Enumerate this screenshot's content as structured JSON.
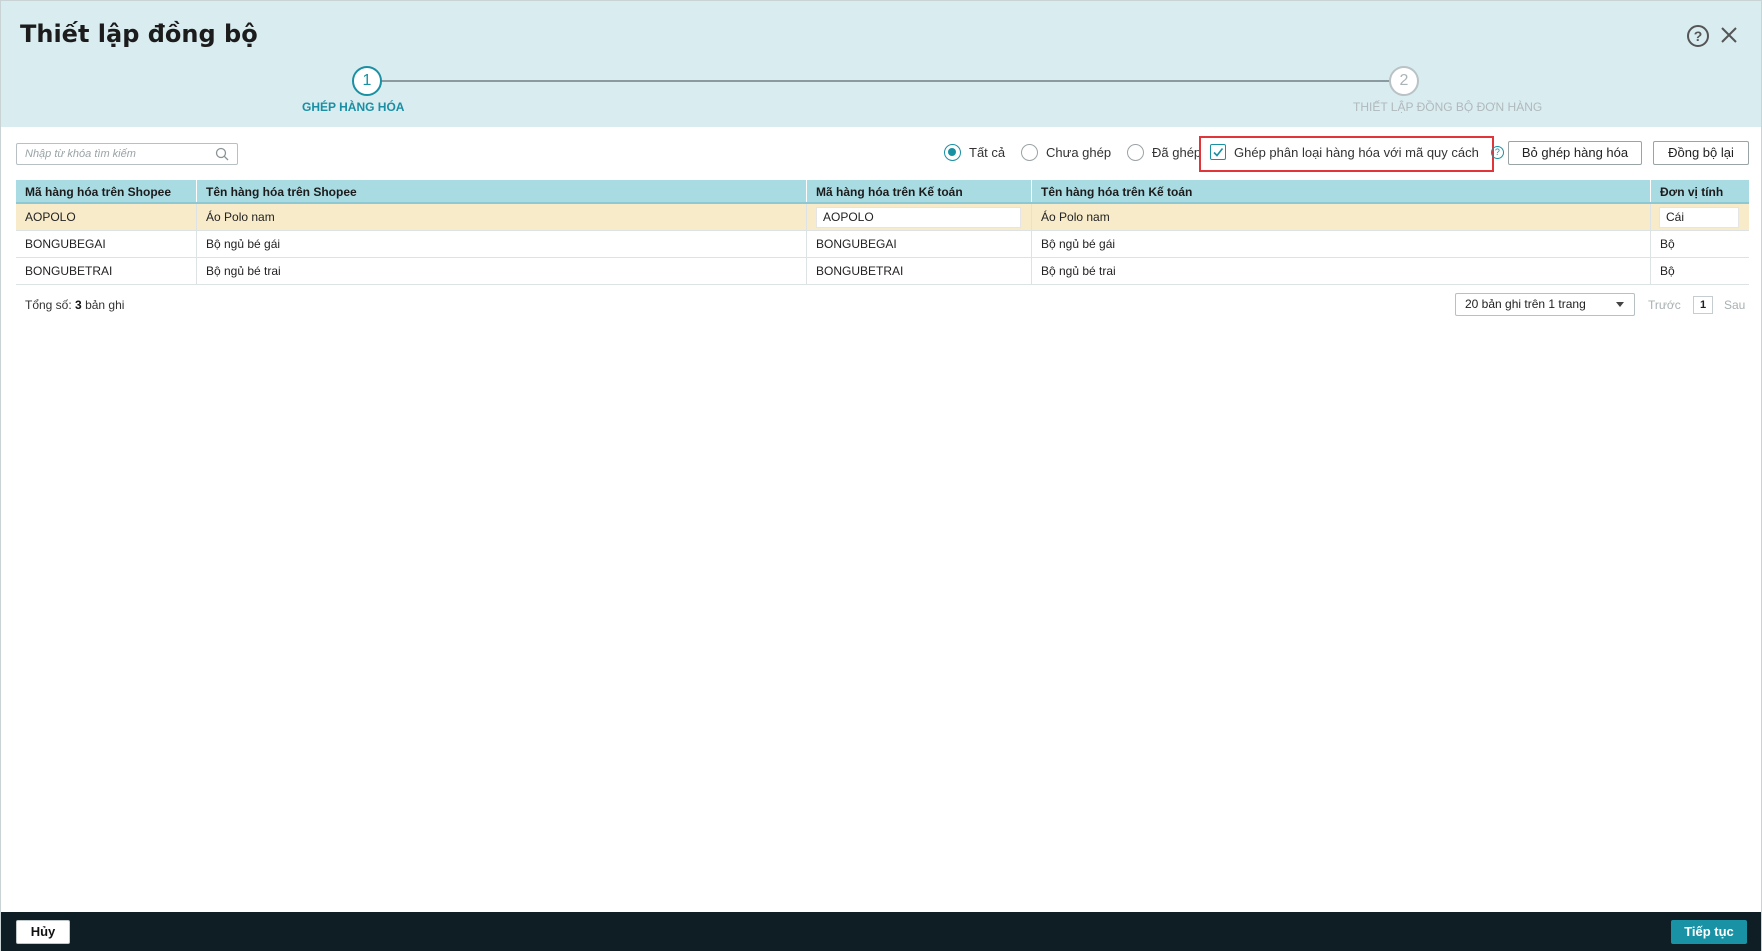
{
  "dialog": {
    "title": "Thiết lập đồng bộ",
    "help_label": "?"
  },
  "stepper": {
    "steps": [
      {
        "number": "1",
        "label": "GHÉP HÀNG HÓA",
        "state": "active"
      },
      {
        "number": "2",
        "label": "THIẾT LẬP ĐỒNG BỘ ĐƠN HÀNG",
        "state": "inactive"
      }
    ]
  },
  "toolbar": {
    "search_placeholder": "Nhập từ khóa tìm kiếm",
    "filters": [
      {
        "label": "Tất cả",
        "checked": true
      },
      {
        "label": "Chưa ghép",
        "checked": false
      },
      {
        "label": "Đã ghép",
        "checked": false
      }
    ],
    "checkbox_label": "Ghép phân loại hàng hóa với mã quy cách",
    "checkbox_checked": true,
    "unmatch_button": "Bỏ ghép hàng hóa",
    "resync_button": "Đồng bộ lại"
  },
  "table": {
    "headers": [
      "Mã hàng hóa trên Shopee",
      "Tên hàng hóa trên Shopee",
      "Mã hàng hóa trên Kế toán",
      "Tên hàng hóa trên Kế toán",
      "Đơn vị tính"
    ],
    "rows": [
      [
        "AOPOLO",
        "Áo Polo nam",
        "AOPOLO",
        "Áo Polo nam",
        "Cái"
      ],
      [
        "BONGUBEGAI",
        "Bộ ngủ bé gái",
        "BONGUBEGAI",
        "Bộ ngủ bé gái",
        "Bộ"
      ],
      [
        "BONGUBETRAI",
        "Bộ ngủ bé trai",
        "BONGUBETRAI",
        "Bộ ngủ bé trai",
        "Bộ"
      ]
    ]
  },
  "summary": {
    "total_prefix": "Tổng số:",
    "total_count": "3",
    "total_suffix": "bản ghi"
  },
  "pager": {
    "page_size": "20 bản ghi trên 1 trang",
    "prev": "Trước",
    "current": "1",
    "next": "Sau"
  },
  "footer": {
    "cancel": "Hủy",
    "continue": "Tiếp tục"
  },
  "colors": {
    "accent": "#1a90a3",
    "header_bg": "#d9ecf0",
    "table_header": "#a9dbe3",
    "selected_row": "#f7ebca",
    "highlight_border": "#e0363a",
    "footer_bg": "#0f1e25"
  }
}
